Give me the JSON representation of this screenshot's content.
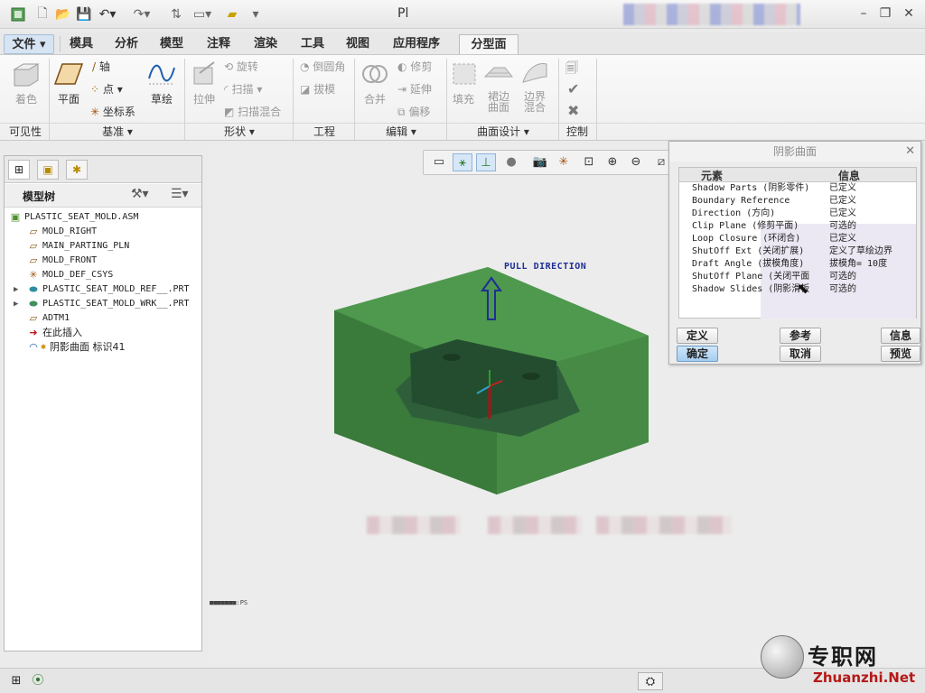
{
  "window": {
    "title": "Pl"
  },
  "ribbon_tabs": {
    "file": "文件",
    "items": [
      "模具",
      "分析",
      "模型",
      "注释",
      "渲染",
      "工具",
      "视图",
      "应用程序",
      "分型面"
    ]
  },
  "ribbon": {
    "shading": "着色",
    "plane": "平面",
    "axis": "轴",
    "point": "点",
    "csys": "坐标系",
    "sketch": "草绘",
    "extrude": "拉伸",
    "revolve": "旋转",
    "sweep": "扫描",
    "swept_blend": "扫描混合",
    "round": "倒圆角",
    "draft": "拔模",
    "merge": "合并",
    "trim": "修剪",
    "extend": "延伸",
    "offset": "偏移",
    "fill": "填充",
    "skirt": [
      "裙边",
      "曲面"
    ],
    "boundary": [
      "边界",
      "混合"
    ],
    "groups": {
      "visibility": "可见性",
      "datum": "基准",
      "shapes": "形状",
      "engineering": "工程",
      "editing": "编辑",
      "surface_design": "曲面设计",
      "control": "控制"
    }
  },
  "model_tree": {
    "title": "模型树",
    "rows": [
      "PLASTIC_SEAT_MOLD.ASM",
      "MOLD_RIGHT",
      "MAIN_PARTING_PLN",
      "MOLD_FRONT",
      "MOLD_DEF_CSYS",
      "PLASTIC_SEAT_MOLD_REF__.PRT",
      "PLASTIC_SEAT_MOLD_WRK__.PRT",
      "ADTM1",
      "在此插入",
      "阴影曲面 标识41"
    ]
  },
  "graphics": {
    "pull_direction": "PULL DIRECTION",
    "status_text": "■■■■■■■:PS"
  },
  "dialog": {
    "title": "阴影曲面",
    "col_element": "元素",
    "col_info": "信息",
    "rows": [
      {
        "element": "Shadow Parts (阴影零件)",
        "info": "已定义"
      },
      {
        "element": "Boundary Reference",
        "info": "已定义"
      },
      {
        "element": "Direction (方向)",
        "info": "已定义"
      },
      {
        "element": "Clip Plane (修剪平面)",
        "info": "可选的"
      },
      {
        "element": "Loop Closure (环闭合)",
        "info": "已定义"
      },
      {
        "element": "ShutOff Ext (关闭扩展)",
        "info": "定义了草绘边界"
      },
      {
        "element": "Draft Angle (拔模角度)",
        "info": "拔模角= 10度"
      },
      {
        "element": "ShutOff Plane (关闭平面",
        "info": "可选的"
      },
      {
        "element": "Shadow Slides (阴影滑板",
        "info": "可选的"
      }
    ],
    "buttons": {
      "define": "定义",
      "refs": "参考",
      "info": "信息",
      "ok": "确定",
      "cancel": "取消",
      "preview": "预览"
    }
  },
  "watermark": {
    "cn": "专职网",
    "en": "Zhuanzhi.Net"
  },
  "colors": {
    "mold_green": "#3f7f3f",
    "pull_arrow": "#1f2e94",
    "accent": "#a6cdf0"
  }
}
